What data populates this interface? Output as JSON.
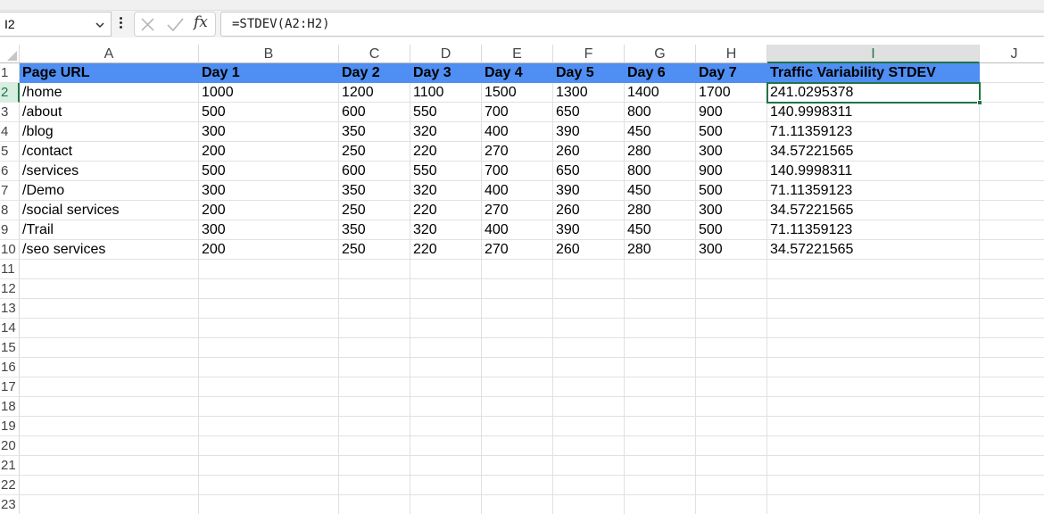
{
  "namebox": {
    "value": "I2"
  },
  "formula_bar": {
    "content": "=STDEV(A2:H2)",
    "fx_label": "fx"
  },
  "selected_cell": {
    "column": "I",
    "row": "2"
  },
  "colors": {
    "header_fill": "#4f8ef2",
    "selection": "#217346"
  },
  "columns": [
    "A",
    "B",
    "C",
    "D",
    "E",
    "F",
    "G",
    "H",
    "I",
    "J"
  ],
  "rows": [
    "1",
    "2",
    "3",
    "4",
    "5",
    "6",
    "7",
    "8",
    "9",
    "10",
    "11",
    "12",
    "13",
    "14",
    "15",
    "16",
    "17",
    "18",
    "19",
    "20",
    "21",
    "22",
    "23"
  ],
  "sheet": {
    "header": [
      "Page URL",
      "Day 1",
      "Day 2",
      "Day 3",
      "Day 4",
      "Day 5",
      "Day 6",
      "Day 7",
      "Traffic Variability STDEV",
      ""
    ],
    "data": [
      [
        "/home",
        "1000",
        "1200",
        "1100",
        "1500",
        "1300",
        "1400",
        "1700",
        "241.0295378",
        ""
      ],
      [
        "/about",
        "500",
        "600",
        "550",
        "700",
        "650",
        "800",
        "900",
        "140.9998311",
        ""
      ],
      [
        "/blog",
        "300",
        "350",
        "320",
        "400",
        "390",
        "450",
        "500",
        "71.11359123",
        ""
      ],
      [
        "/contact",
        "200",
        "250",
        "220",
        "270",
        "260",
        "280",
        "300",
        "34.57221565",
        ""
      ],
      [
        "/services",
        "500",
        "600",
        "550",
        "700",
        "650",
        "800",
        "900",
        "140.9998311",
        ""
      ],
      [
        "/Demo",
        "300",
        "350",
        "320",
        "400",
        "390",
        "450",
        "500",
        "71.11359123",
        ""
      ],
      [
        "/social services",
        "200",
        "250",
        "220",
        "270",
        "260",
        "280",
        "300",
        "34.57221565",
        ""
      ],
      [
        "/Trail",
        "300",
        "350",
        "320",
        "400",
        "390",
        "450",
        "500",
        "71.11359123",
        ""
      ],
      [
        "/seo services",
        "200",
        "250",
        "220",
        "270",
        "260",
        "280",
        "300",
        "34.57221565",
        ""
      ]
    ]
  }
}
